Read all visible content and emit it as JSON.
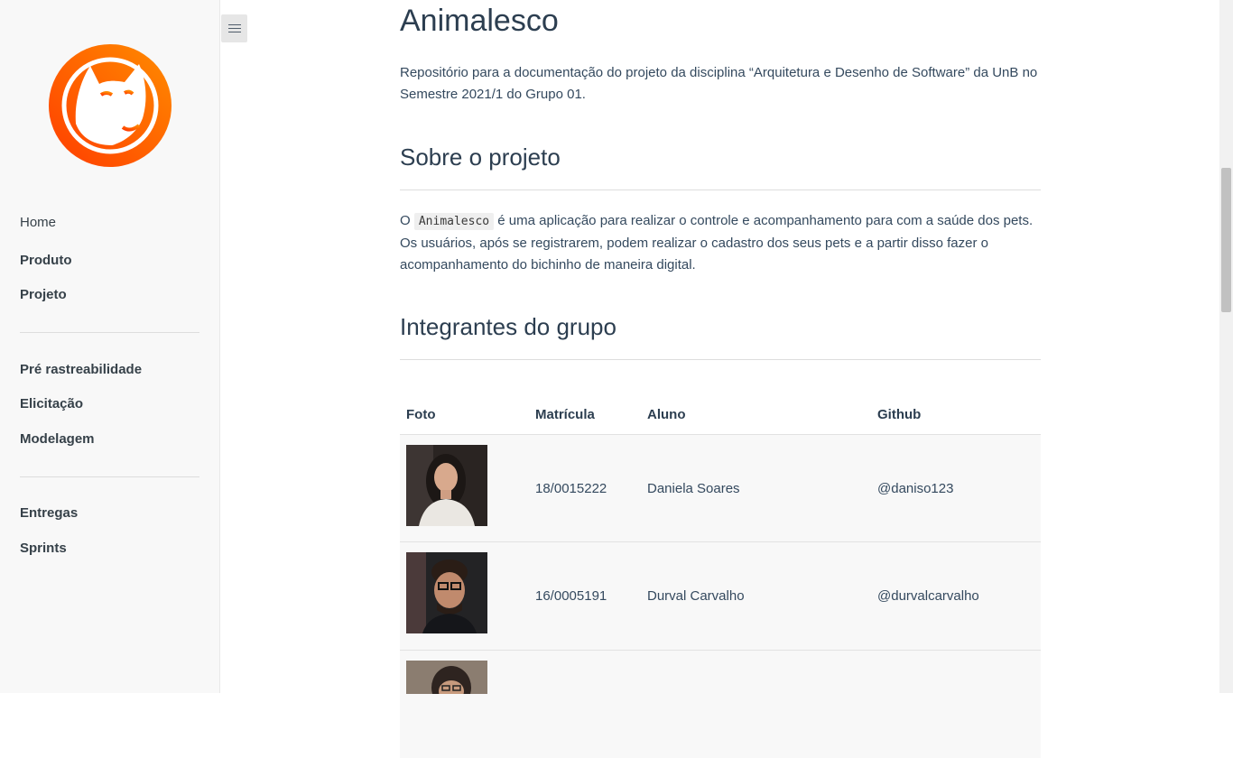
{
  "sidebar": {
    "logo_alt": "Animalesco cat logo",
    "colors": {
      "logo_orange": "#ff7a00",
      "logo_red": "#ff4a00"
    },
    "items": [
      {
        "label": "Home",
        "bold": false
      },
      {
        "label": "Produto",
        "bold": true
      },
      {
        "label": "Projeto",
        "bold": true
      },
      {
        "label": "Pré rastreabilidade",
        "bold": true
      },
      {
        "label": "Elicitação",
        "bold": true
      },
      {
        "label": "Modelagem",
        "bold": true
      },
      {
        "label": "Entregas",
        "bold": true
      },
      {
        "label": "Sprints",
        "bold": true
      }
    ]
  },
  "toggle": {
    "icon": "hamburger-menu-icon"
  },
  "main": {
    "title": "Animalesco",
    "intro": "Repositório para a documentação do projeto da disciplina “Arquitetura e Desenho de Software” da UnB no Semestre 2021/1 do Grupo 01.",
    "about": {
      "heading": "Sobre o projeto",
      "text_before": "O ",
      "code": "Animalesco",
      "text_after": " é uma aplicação para realizar o controle e acompanhamento para com a saúde dos pets. Os usuários, após se registrarem, podem realizar o cadastro dos seus pets e a partir disso fazer o acompanhamento do bichinho de maneira digital."
    },
    "members": {
      "heading": "Integrantes do grupo",
      "columns": [
        "Foto",
        "Matrícula",
        "Aluno",
        "Github"
      ],
      "rows": [
        {
          "matricula": "18/0015222",
          "aluno": "Daniela Soares",
          "github": "@daniso123"
        },
        {
          "matricula": "16/0005191",
          "aluno": "Durval Carvalho",
          "github": "@durvalcarvalho"
        },
        {
          "matricula": "",
          "aluno": "",
          "github": ""
        }
      ]
    }
  }
}
